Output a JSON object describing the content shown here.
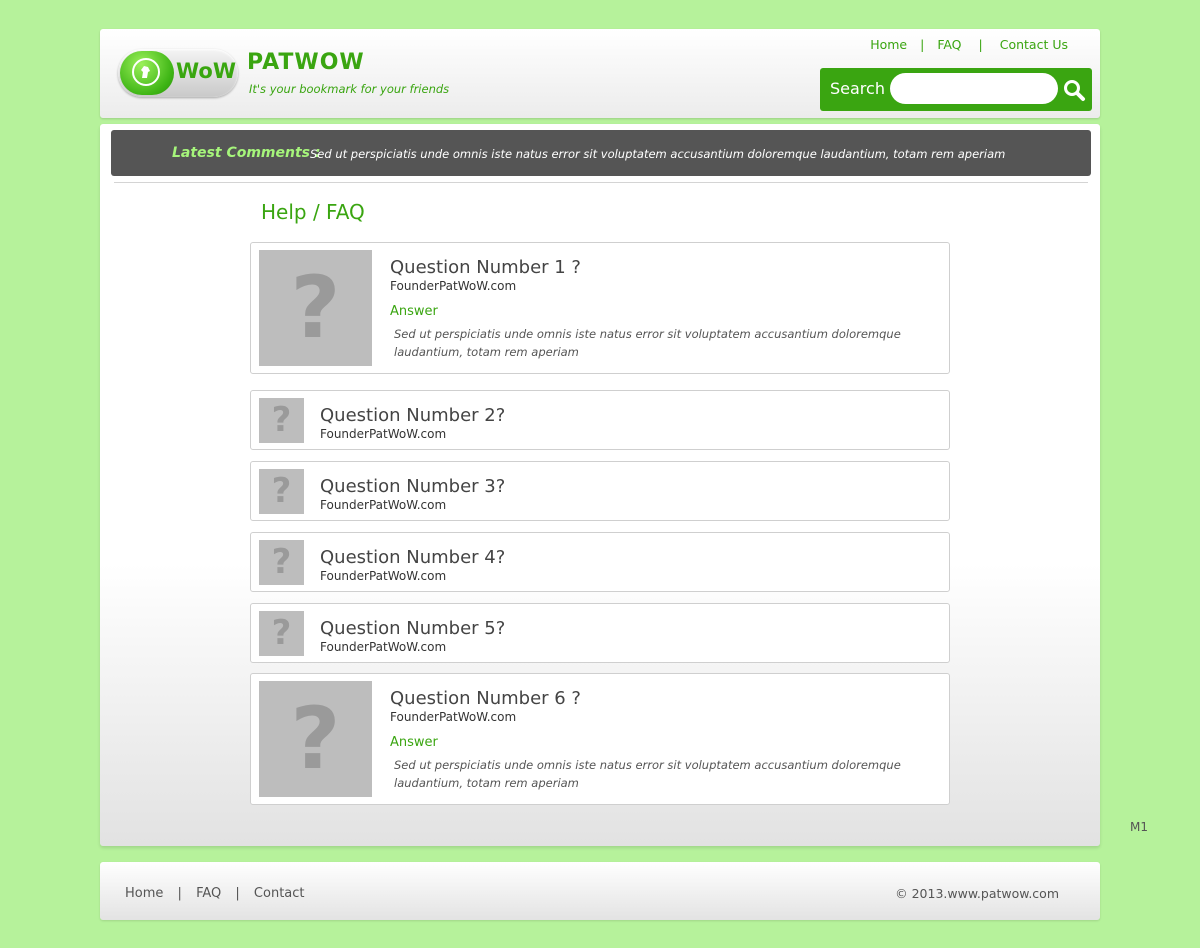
{
  "header": {
    "logo_text": "WoW",
    "brand_name": "PATWOW",
    "tagline": "It's your bookmark for your friends",
    "nav": [
      "Home",
      "FAQ",
      "Contact Us"
    ],
    "nav_separator": "|",
    "search_label": "Search",
    "search_placeholder": ""
  },
  "latest_comments": {
    "label": "Latest Comments :",
    "text": "Sed ut perspiciatis unde omnis iste natus error sit voluptatem accusantium doloremque laudantium, totam rem aperiam"
  },
  "page_title": "Help / FAQ",
  "question_mark": "?",
  "faq": [
    {
      "title": "Question Number 1 ?",
      "author": "FounderPatWoW.com",
      "answer_label": "Answer",
      "answer_text": "Sed ut perspiciatis unde omnis iste natus error sit voluptatem accusantium doloremque laudantium, totam rem aperiam"
    },
    {
      "title": "Question Number 2?",
      "author": "FounderPatWoW.com"
    },
    {
      "title": "Question Number 3?",
      "author": "FounderPatWoW.com"
    },
    {
      "title": "Question Number 4?",
      "author": "FounderPatWoW.com"
    },
    {
      "title": "Question Number 5?",
      "author": "FounderPatWoW.com"
    },
    {
      "title": "Question Number 6 ?",
      "author": "FounderPatWoW.com",
      "answer_label": "Answer",
      "answer_text": "Sed ut perspiciatis unde omnis iste natus error sit voluptatem accusantium doloremque laudantium, totam rem aperiam"
    }
  ],
  "corner_label": "M1",
  "footer": {
    "nav": [
      "Home",
      "FAQ",
      "Contact"
    ],
    "separator": "|",
    "copyright": "© 2013.www.patwow.com"
  },
  "colors": {
    "page_background": "#b6f29b",
    "brand_green": "#3aa511",
    "comments_bar": "#555555",
    "comments_label": "#a6f57b",
    "placeholder_gray": "#bdbdbd"
  },
  "icons": {
    "search": "magnifier-icon",
    "question": "question-mark-icon",
    "logo": "horse-head-icon"
  }
}
